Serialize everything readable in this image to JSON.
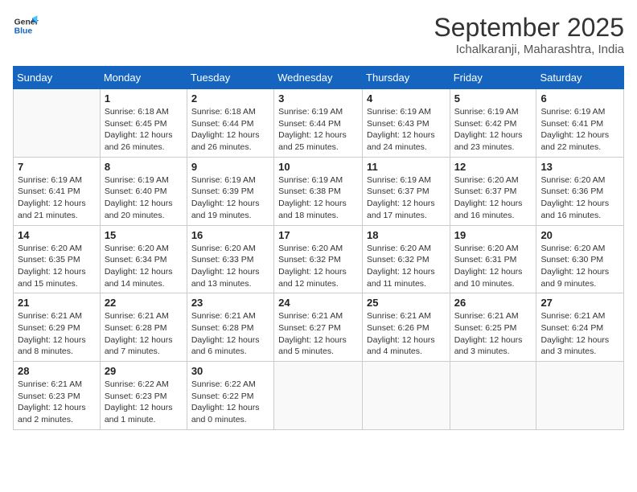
{
  "logo": {
    "line1": "General",
    "line2": "Blue"
  },
  "title": "September 2025",
  "subtitle": "Ichalkaranji, Maharashtra, India",
  "weekdays": [
    "Sunday",
    "Monday",
    "Tuesday",
    "Wednesday",
    "Thursday",
    "Friday",
    "Saturday"
  ],
  "weeks": [
    [
      {
        "day": "",
        "sunrise": "",
        "sunset": "",
        "daylight": ""
      },
      {
        "day": "1",
        "sunrise": "6:18 AM",
        "sunset": "6:45 PM",
        "daylight": "12 hours and 26 minutes."
      },
      {
        "day": "2",
        "sunrise": "6:18 AM",
        "sunset": "6:44 PM",
        "daylight": "12 hours and 26 minutes."
      },
      {
        "day": "3",
        "sunrise": "6:19 AM",
        "sunset": "6:44 PM",
        "daylight": "12 hours and 25 minutes."
      },
      {
        "day": "4",
        "sunrise": "6:19 AM",
        "sunset": "6:43 PM",
        "daylight": "12 hours and 24 minutes."
      },
      {
        "day": "5",
        "sunrise": "6:19 AM",
        "sunset": "6:42 PM",
        "daylight": "12 hours and 23 minutes."
      },
      {
        "day": "6",
        "sunrise": "6:19 AM",
        "sunset": "6:41 PM",
        "daylight": "12 hours and 22 minutes."
      }
    ],
    [
      {
        "day": "7",
        "sunrise": "6:19 AM",
        "sunset": "6:41 PM",
        "daylight": "12 hours and 21 minutes."
      },
      {
        "day": "8",
        "sunrise": "6:19 AM",
        "sunset": "6:40 PM",
        "daylight": "12 hours and 20 minutes."
      },
      {
        "day": "9",
        "sunrise": "6:19 AM",
        "sunset": "6:39 PM",
        "daylight": "12 hours and 19 minutes."
      },
      {
        "day": "10",
        "sunrise": "6:19 AM",
        "sunset": "6:38 PM",
        "daylight": "12 hours and 18 minutes."
      },
      {
        "day": "11",
        "sunrise": "6:19 AM",
        "sunset": "6:37 PM",
        "daylight": "12 hours and 17 minutes."
      },
      {
        "day": "12",
        "sunrise": "6:20 AM",
        "sunset": "6:37 PM",
        "daylight": "12 hours and 16 minutes."
      },
      {
        "day": "13",
        "sunrise": "6:20 AM",
        "sunset": "6:36 PM",
        "daylight": "12 hours and 16 minutes."
      }
    ],
    [
      {
        "day": "14",
        "sunrise": "6:20 AM",
        "sunset": "6:35 PM",
        "daylight": "12 hours and 15 minutes."
      },
      {
        "day": "15",
        "sunrise": "6:20 AM",
        "sunset": "6:34 PM",
        "daylight": "12 hours and 14 minutes."
      },
      {
        "day": "16",
        "sunrise": "6:20 AM",
        "sunset": "6:33 PM",
        "daylight": "12 hours and 13 minutes."
      },
      {
        "day": "17",
        "sunrise": "6:20 AM",
        "sunset": "6:32 PM",
        "daylight": "12 hours and 12 minutes."
      },
      {
        "day": "18",
        "sunrise": "6:20 AM",
        "sunset": "6:32 PM",
        "daylight": "12 hours and 11 minutes."
      },
      {
        "day": "19",
        "sunrise": "6:20 AM",
        "sunset": "6:31 PM",
        "daylight": "12 hours and 10 minutes."
      },
      {
        "day": "20",
        "sunrise": "6:20 AM",
        "sunset": "6:30 PM",
        "daylight": "12 hours and 9 minutes."
      }
    ],
    [
      {
        "day": "21",
        "sunrise": "6:21 AM",
        "sunset": "6:29 PM",
        "daylight": "12 hours and 8 minutes."
      },
      {
        "day": "22",
        "sunrise": "6:21 AM",
        "sunset": "6:28 PM",
        "daylight": "12 hours and 7 minutes."
      },
      {
        "day": "23",
        "sunrise": "6:21 AM",
        "sunset": "6:28 PM",
        "daylight": "12 hours and 6 minutes."
      },
      {
        "day": "24",
        "sunrise": "6:21 AM",
        "sunset": "6:27 PM",
        "daylight": "12 hours and 5 minutes."
      },
      {
        "day": "25",
        "sunrise": "6:21 AM",
        "sunset": "6:26 PM",
        "daylight": "12 hours and 4 minutes."
      },
      {
        "day": "26",
        "sunrise": "6:21 AM",
        "sunset": "6:25 PM",
        "daylight": "12 hours and 3 minutes."
      },
      {
        "day": "27",
        "sunrise": "6:21 AM",
        "sunset": "6:24 PM",
        "daylight": "12 hours and 3 minutes."
      }
    ],
    [
      {
        "day": "28",
        "sunrise": "6:21 AM",
        "sunset": "6:23 PM",
        "daylight": "12 hours and 2 minutes."
      },
      {
        "day": "29",
        "sunrise": "6:22 AM",
        "sunset": "6:23 PM",
        "daylight": "12 hours and 1 minute."
      },
      {
        "day": "30",
        "sunrise": "6:22 AM",
        "sunset": "6:22 PM",
        "daylight": "12 hours and 0 minutes."
      },
      {
        "day": "",
        "sunrise": "",
        "sunset": "",
        "daylight": ""
      },
      {
        "day": "",
        "sunrise": "",
        "sunset": "",
        "daylight": ""
      },
      {
        "day": "",
        "sunrise": "",
        "sunset": "",
        "daylight": ""
      },
      {
        "day": "",
        "sunrise": "",
        "sunset": "",
        "daylight": ""
      }
    ]
  ]
}
